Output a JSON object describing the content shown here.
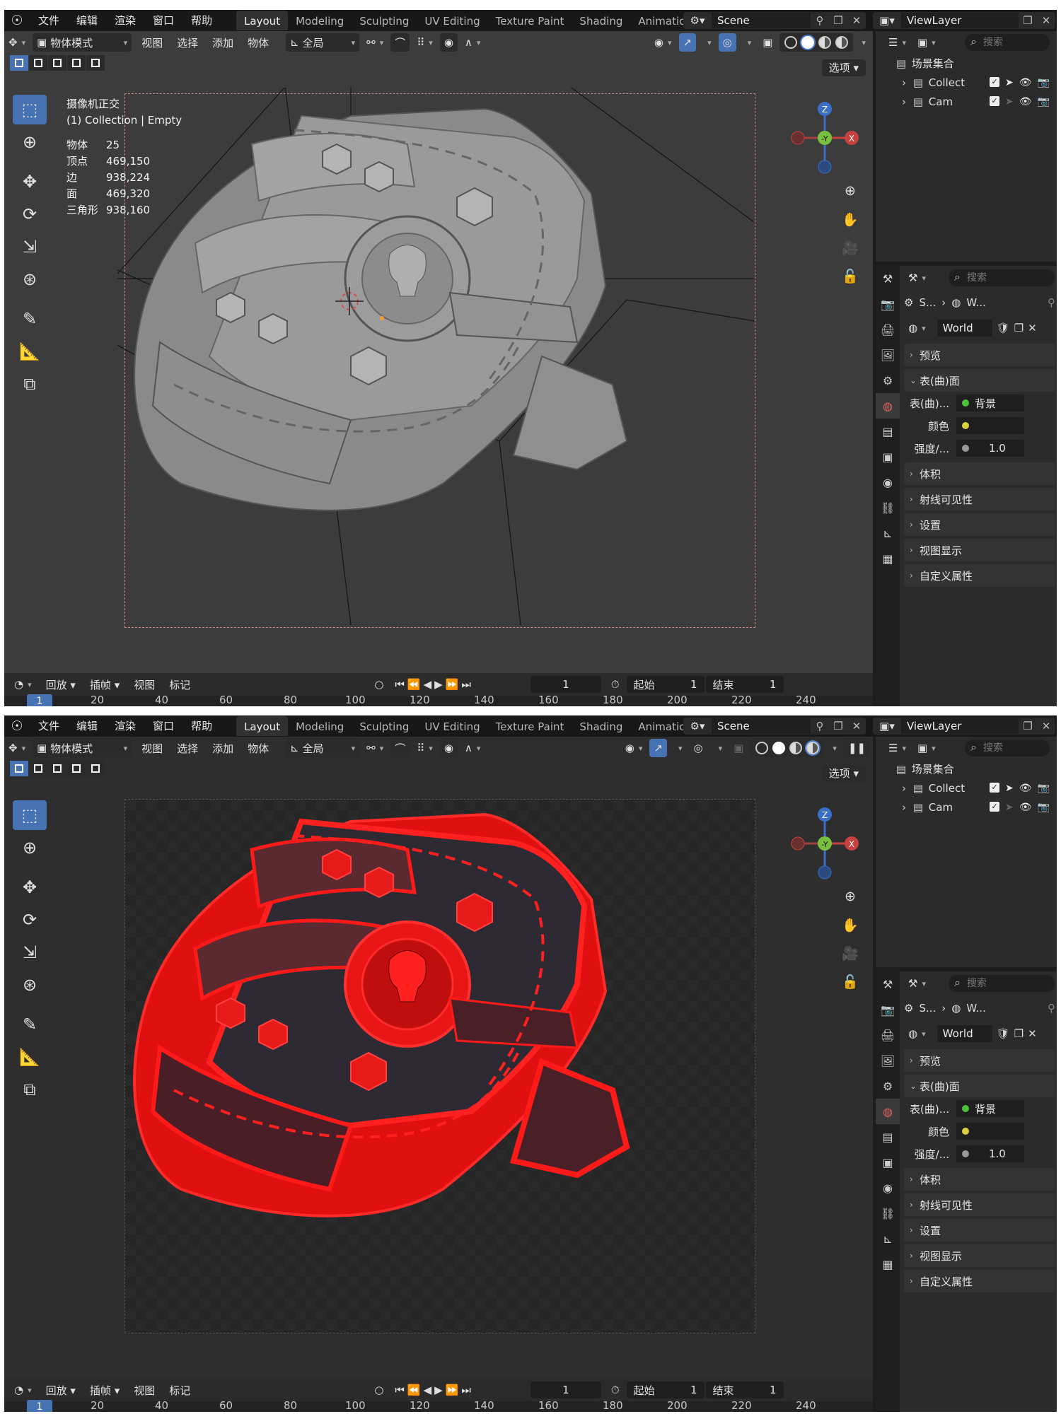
{
  "menu": [
    "文件",
    "编辑",
    "渲染",
    "窗口",
    "帮助"
  ],
  "workspaces": [
    "Layout",
    "Modeling",
    "Sculpting",
    "UV Editing",
    "Texture Paint",
    "Shading",
    "Animation"
  ],
  "scene": "Scene",
  "view_layer": "ViewLayer",
  "viewport": {
    "mode": "物体模式",
    "menus": [
      "视图",
      "选择",
      "添加",
      "物体"
    ],
    "transform": "全局",
    "options": "选项"
  },
  "stats": {
    "view": "摄像机正交",
    "collection": "(1) Collection | Empty",
    "rows": [
      {
        "k": "物体",
        "v": "25"
      },
      {
        "k": "顶点",
        "v": "469,150"
      },
      {
        "k": "边",
        "v": "938,224"
      },
      {
        "k": "面",
        "v": "469,320"
      },
      {
        "k": "三角形",
        "v": "938,160"
      }
    ]
  },
  "gizmo": {
    "z": "Z",
    "y": "-Y",
    "x": "X"
  },
  "timeline": {
    "menus": [
      "回放",
      "插帧",
      "视图",
      "标记"
    ],
    "current": "1",
    "start_label": "起始",
    "start": "1",
    "end_label": "结束",
    "end": "1",
    "ruler": [
      "1",
      "20",
      "40",
      "60",
      "80",
      "100",
      "120",
      "140",
      "160",
      "180",
      "200",
      "220",
      "240"
    ]
  },
  "outliner": {
    "search": "搜索",
    "root": "场景集合",
    "items": [
      "Collect",
      "Cam"
    ]
  },
  "properties": {
    "search": "搜索",
    "crumb_a": "S...",
    "crumb_b": "W...",
    "world": "World",
    "preview": "预览",
    "surface": "表(曲)面",
    "surface_label": "表(曲)...",
    "surface_value": "背景",
    "color_label": "颜色",
    "strength_label": "强度/...",
    "strength_value": "1.0",
    "sections": [
      "体积",
      "射线可见性",
      "设置",
      "视图显示",
      "自定义属性"
    ]
  },
  "colors": {
    "accent": "#4772b3",
    "model_gray": "#8a8a8a",
    "model_red": "#e01010",
    "model_dark": "#3a2a30"
  }
}
